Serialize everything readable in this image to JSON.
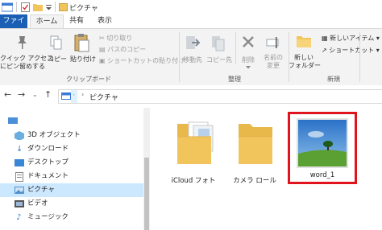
{
  "window": {
    "title": "ピクチャ"
  },
  "ribbon_tabs": [
    "ファイル",
    "ホーム",
    "共有",
    "表示"
  ],
  "clipboard": {
    "pin_label_1": "クイック アクセス",
    "pin_label_2": "にピン留めする",
    "copy_label": "コピー",
    "paste_label": "貼り付け",
    "cut_label": "切り取り",
    "copy_path_label": "パスのコピー",
    "paste_shortcut_label": "ショートカットの貼り付け",
    "group_label": "クリップボード"
  },
  "organize": {
    "move_label": "移動先",
    "copy_to_label": "コピー先",
    "delete_label": "削除",
    "rename_label_1": "名前の",
    "rename_label_2": "変更",
    "group_label": "整理"
  },
  "new": {
    "new_folder_label_1": "新しい",
    "new_folder_label_2": "フォルダー",
    "new_item_label": "新しいアイテム",
    "shortcut_label": "ショートカット",
    "group_label": "新規"
  },
  "address": {
    "path": "ピクチャ"
  },
  "nav_items": [
    {
      "label": "3D オブジェクト",
      "icon": "3d-objects-icon"
    },
    {
      "label": "ダウンロード",
      "icon": "download-icon"
    },
    {
      "label": "デスクトップ",
      "icon": "desktop-icon"
    },
    {
      "label": "ドキュメント",
      "icon": "document-icon"
    },
    {
      "label": "ピクチャ",
      "icon": "pictures-icon",
      "selected": true
    },
    {
      "label": "ビデオ",
      "icon": "video-icon"
    },
    {
      "label": "ミュージック",
      "icon": "music-icon"
    }
  ],
  "files": [
    {
      "name": "iCloud フォト",
      "type": "folder"
    },
    {
      "name": "カメラ ロール",
      "type": "folder"
    },
    {
      "name": "word_1",
      "type": "image"
    }
  ],
  "colors": {
    "file_tab": "#1a5fb4",
    "selection": "#cce8ff",
    "highlight_frame": "#e0141c",
    "folder": "#f2c55c"
  }
}
